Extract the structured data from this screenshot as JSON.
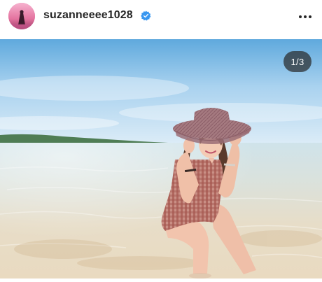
{
  "post": {
    "username": "suzanneeee1028",
    "verified": true,
    "more_icon": "more-horizontal-icon",
    "avatar_icon": "profile-avatar",
    "carousel_counter": "1/3",
    "colors": {
      "verified_blue": "#3897f0",
      "text": "#262626",
      "counter_bg": "#262626"
    }
  }
}
